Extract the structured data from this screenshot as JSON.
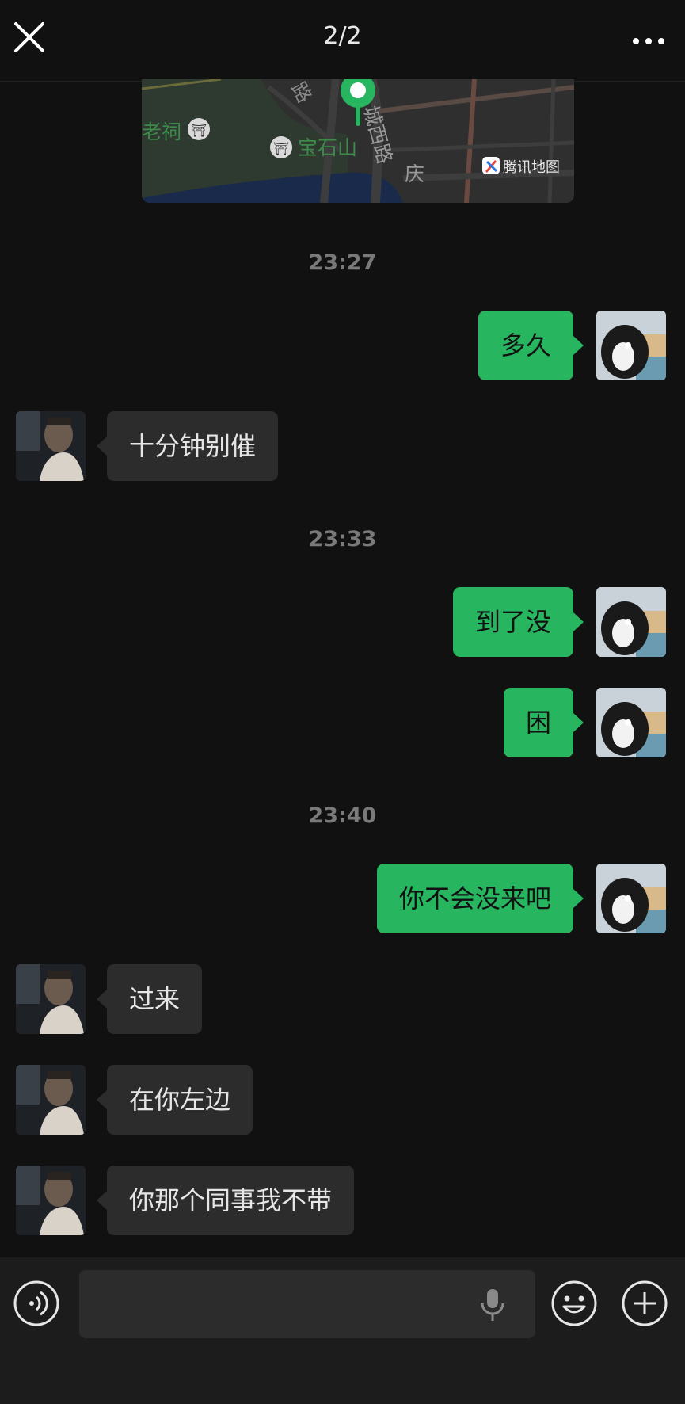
{
  "header": {
    "page_indicator": "2/2",
    "close_icon": "close-icon",
    "more_icon": "more-icon"
  },
  "map": {
    "labels": {
      "laoci": "老祠",
      "baoshishan": "宝石山",
      "chengxilu": "城西路",
      "qing": "庆",
      "lu_top": "路",
      "brand": "腾讯地图"
    },
    "colors": {
      "pin": "#27b560",
      "water": "#1a2a4a",
      "land": "#2f2f2f"
    }
  },
  "timestamps": [
    "23:27",
    "23:33",
    "23:40"
  ],
  "messages": [
    {
      "side": "out",
      "text": "多久"
    },
    {
      "side": "in",
      "text": "十分钟别催"
    },
    {
      "side": "out",
      "text": "到了没"
    },
    {
      "side": "out",
      "text": "困"
    },
    {
      "side": "out",
      "text": "你不会没来吧"
    },
    {
      "side": "in",
      "text": "过来"
    },
    {
      "side": "in",
      "text": "在你左边"
    },
    {
      "side": "in",
      "text": "你那个同事我不带"
    }
  ],
  "input_bar": {
    "voice_icon": "voice-icon",
    "mic_icon": "microphone-icon",
    "emoji_icon": "emoji-icon",
    "plus_icon": "plus-icon",
    "text_value": ""
  },
  "colors": {
    "background": "#111111",
    "outgoing_bubble": "#27b560",
    "incoming_bubble": "#2c2c2c",
    "timestamp": "#7a7a7a"
  }
}
